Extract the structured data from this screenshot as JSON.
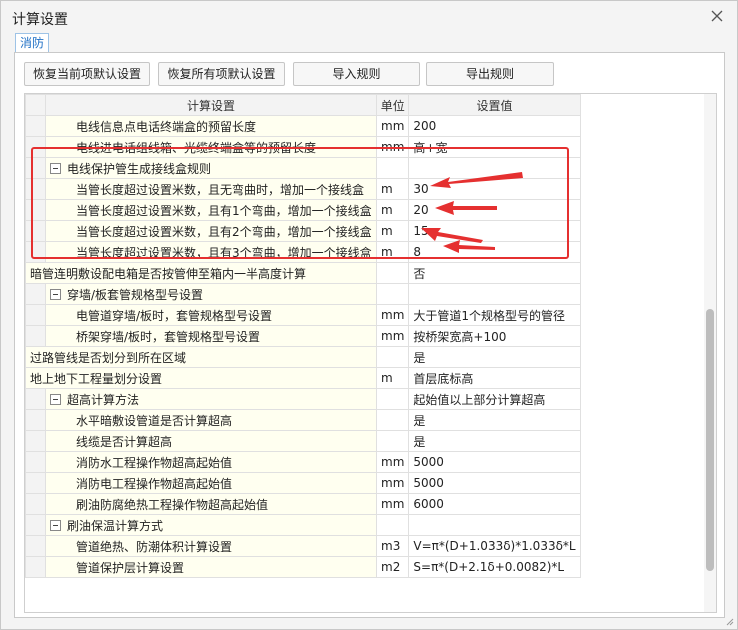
{
  "window": {
    "title": "计算设置",
    "tab": "消防"
  },
  "toolbar": {
    "restore_current": "恢复当前项默认设置",
    "restore_all": "恢复所有项默认设置",
    "import_rules": "导入规则",
    "export_rules": "导出规则"
  },
  "grid": {
    "headers": {
      "name": "计算设置",
      "unit": "单位",
      "value": "设置值"
    },
    "rows": [
      {
        "name": "电线信息点电话终端盒的预留长度",
        "unit": "mm",
        "value": "200"
      },
      {
        "name": "电线进电话组线箱、光缆终端盒等的预留长度",
        "unit": "mm",
        "value": "高+宽"
      },
      {
        "name": "电线保护管生成接线盒规则",
        "unit": "",
        "value": ""
      },
      {
        "name": "当管长度超过设置米数，且无弯曲时，增加一个接线盒",
        "unit": "m",
        "value": "30"
      },
      {
        "name": "当管长度超过设置米数，且有1个弯曲，增加一个接线盒",
        "unit": "m",
        "value": "20"
      },
      {
        "name": "当管长度超过设置米数，且有2个弯曲，增加一个接线盒",
        "unit": "m",
        "value": "15"
      },
      {
        "name": "当管长度超过设置米数，且有3个弯曲，增加一个接线盒",
        "unit": "m",
        "value": "8"
      },
      {
        "name": "暗管连明敷设配电箱是否按管伸至箱内一半高度计算",
        "unit": "",
        "value": "否"
      },
      {
        "name": "穿墙/板套管规格型号设置",
        "unit": "",
        "value": ""
      },
      {
        "name": "电管道穿墙/板时，套管规格型号设置",
        "unit": "mm",
        "value": "大于管道1个规格型号的管径"
      },
      {
        "name": "桥架穿墙/板时，套管规格型号设置",
        "unit": "mm",
        "value": "按桥架宽高+100"
      },
      {
        "name": "过路管线是否划分到所在区域",
        "unit": "",
        "value": "是"
      },
      {
        "name": "地上地下工程量划分设置",
        "unit": "m",
        "value": "首层底标高"
      },
      {
        "name": "超高计算方法",
        "unit": "",
        "value": "起始值以上部分计算超高"
      },
      {
        "name": "水平暗敷设管道是否计算超高",
        "unit": "",
        "value": "是"
      },
      {
        "name": "线缆是否计算超高",
        "unit": "",
        "value": "是"
      },
      {
        "name": "消防水工程操作物超高起始值",
        "unit": "mm",
        "value": "5000"
      },
      {
        "name": "消防电工程操作物超高起始值",
        "unit": "mm",
        "value": "5000"
      },
      {
        "name": "刷油防腐绝热工程操作物超高起始值",
        "unit": "mm",
        "value": "6000"
      },
      {
        "name": "刷油保温计算方式",
        "unit": "",
        "value": ""
      },
      {
        "name": "管道绝热、防潮体积计算设置",
        "unit": "m3",
        "value": "V=π*(D+1.033δ)*1.033δ*L"
      },
      {
        "name": "管道保护层计算设置",
        "unit": "m2",
        "value": "S=π*(D+2.1δ+0.0082)*L"
      }
    ]
  },
  "colors": {
    "highlight": "#e53030",
    "tab_text": "#1e6fc5",
    "name_cell_bg": "#fffff0"
  }
}
